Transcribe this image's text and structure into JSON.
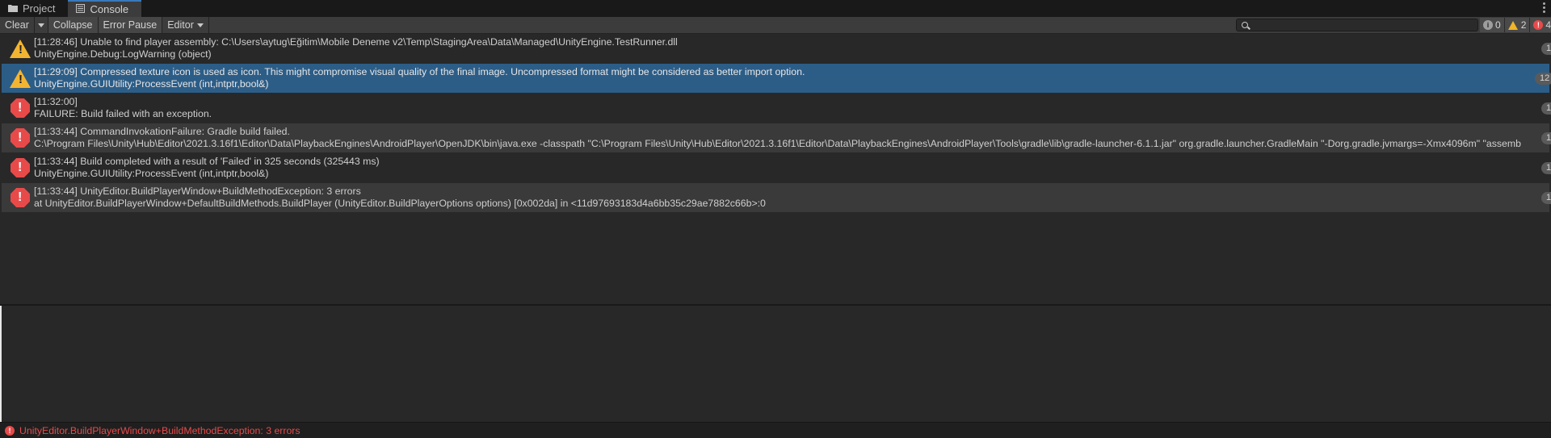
{
  "tabs": [
    {
      "label": "Project",
      "icon": "folder-icon"
    },
    {
      "label": "Console",
      "icon": "console-icon"
    }
  ],
  "toolbar": {
    "clear_label": "Clear",
    "collapse_label": "Collapse",
    "error_pause_label": "Error Pause",
    "editor_label": "Editor"
  },
  "search": {
    "placeholder": "",
    "value": ""
  },
  "counters": {
    "info": "0",
    "warnings": "2",
    "errors": "4"
  },
  "entries": [
    {
      "type": "warning",
      "line1": "[11:28:46] Unable to find player assembly: C:\\Users\\aytug\\Eğitim\\Mobile Deneme v2\\Temp\\StagingArea\\Data\\Managed\\UnityEngine.TestRunner.dll",
      "line2": "UnityEngine.Debug:LogWarning (object)",
      "count": "1"
    },
    {
      "type": "warning",
      "line1": "[11:29:09] Compressed texture icon is used as icon. This might compromise visual quality of the final image. Uncompressed format might be considered as better import option.",
      "line2": "UnityEngine.GUIUtility:ProcessEvent (int,intptr,bool&)",
      "count": "12"
    },
    {
      "type": "error",
      "line1": "[11:32:00]",
      "line2": "FAILURE: Build failed with an exception.",
      "count": "1"
    },
    {
      "type": "error",
      "line1": "[11:33:44] CommandInvokationFailure: Gradle build failed.",
      "line2": "C:\\Program Files\\Unity\\Hub\\Editor\\2021.3.16f1\\Editor\\Data\\PlaybackEngines\\AndroidPlayer\\OpenJDK\\bin\\java.exe -classpath \"C:\\Program Files\\Unity\\Hub\\Editor\\2021.3.16f1\\Editor\\Data\\PlaybackEngines\\AndroidPlayer\\Tools\\gradle\\lib\\gradle-launcher-6.1.1.jar\" org.gradle.launcher.GradleMain \"-Dorg.gradle.jvmargs=-Xmx4096m\" \"assemb",
      "count": "1"
    },
    {
      "type": "error",
      "line1": "[11:33:44] Build completed with a result of 'Failed' in 325 seconds (325443 ms)",
      "line2": "UnityEngine.GUIUtility:ProcessEvent (int,intptr,bool&)",
      "count": "1"
    },
    {
      "type": "error",
      "line1": "[11:33:44] UnityEditor.BuildPlayerWindow+BuildMethodException: 3 errors",
      "line2": "  at UnityEditor.BuildPlayerWindow+DefaultBuildMethods.BuildPlayer (UnityEditor.BuildPlayerOptions options) [0x002da] in <11d97693183d4a6bb35c29ae7882c66b>:0",
      "count": "1"
    }
  ],
  "status": {
    "message": "UnityEditor.BuildPlayerWindow+BuildMethodException: 3 errors"
  },
  "colors": {
    "warning": "#f2b531",
    "error": "#e84a4a",
    "selected": "#2c5d87",
    "accent": "#3a79bb"
  }
}
